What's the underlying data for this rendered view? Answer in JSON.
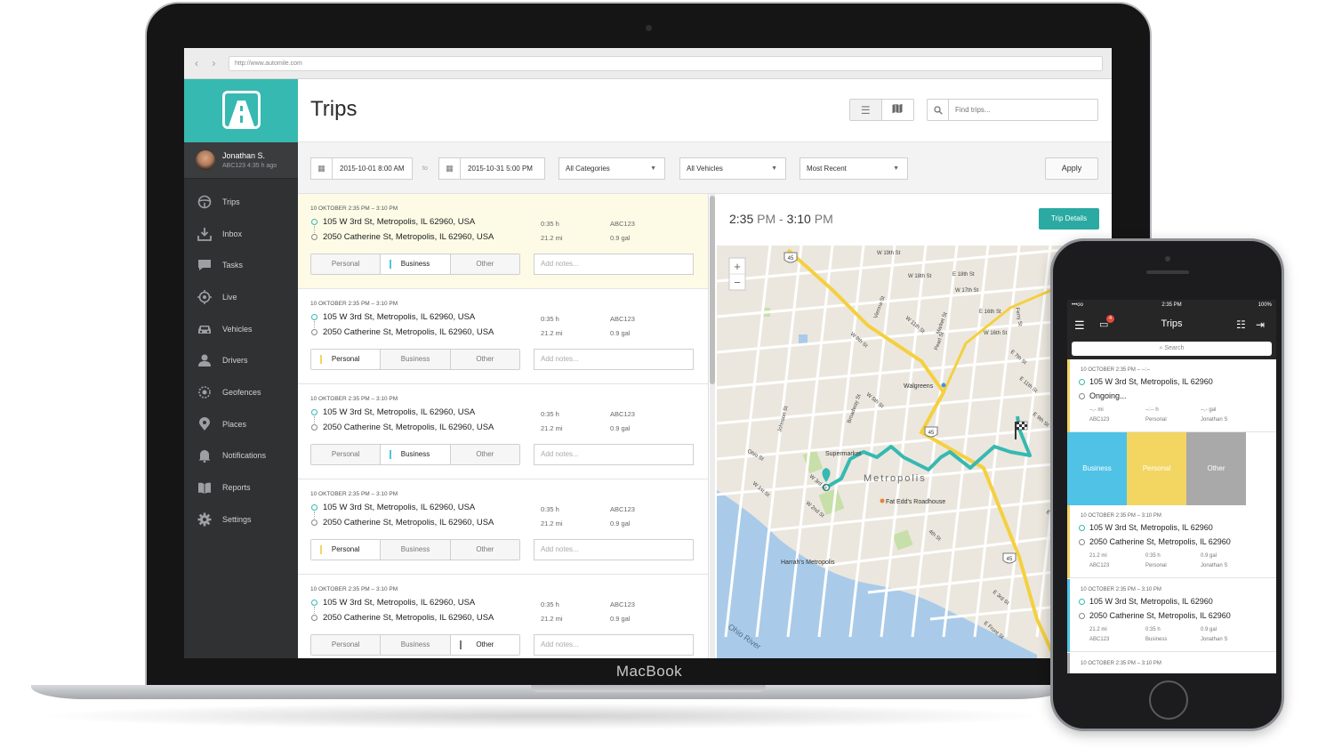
{
  "device": {
    "brand": "MacBook"
  },
  "browser": {
    "url": "http://www.automile.com"
  },
  "colors": {
    "accent": "#36b9b1",
    "personal": "#f3d561",
    "business": "#4fc2e6",
    "other": "#a9a9a9",
    "sidebar": "#2f3133"
  },
  "user": {
    "name": "Jonathan S.",
    "sub": "ABC123 4:35 h ago"
  },
  "sidebar": {
    "items": [
      {
        "label": "Trips",
        "icon": "steering-wheel-icon"
      },
      {
        "label": "Inbox",
        "icon": "inbox-download-icon"
      },
      {
        "label": "Tasks",
        "icon": "chat-bubble-icon"
      },
      {
        "label": "Live",
        "icon": "crosshair-icon"
      },
      {
        "label": "Vehicles",
        "icon": "car-icon"
      },
      {
        "label": "Drivers",
        "icon": "person-icon"
      },
      {
        "label": "Geofences",
        "icon": "geofence-icon"
      },
      {
        "label": "Places",
        "icon": "map-pin-icon"
      },
      {
        "label": "Notifications",
        "icon": "bell-icon"
      },
      {
        "label": "Reports",
        "icon": "book-icon"
      },
      {
        "label": "Settings",
        "icon": "gear-icon"
      }
    ]
  },
  "header": {
    "title": "Trips",
    "search_placeholder": "Find trips..."
  },
  "filters": {
    "date_from": "2015-10-01 8:00 AM",
    "to_label": "to",
    "date_to": "2015-10-31 5:00 PM",
    "category": "All Categories",
    "vehicle": "All Vehicles",
    "sort": "Most Recent",
    "apply_label": "Apply"
  },
  "categories": {
    "personal": "Personal",
    "business": "Business",
    "other": "Other",
    "notes_placeholder": "Add notes..."
  },
  "trips": [
    {
      "time": "10 OKTOBER 2:35 PM – 3:10 PM",
      "from": "105 W 3rd St, Metropolis, IL 62960, USA",
      "to": "2050 Catherine St, Metropolis, IL 62960, USA",
      "duration": "0:35 h",
      "distance": "21.2 mi",
      "vehicle": "ABC123",
      "fuel": "0.9 gal",
      "category": "business",
      "highlighted": true
    },
    {
      "time": "10 OKTOBER 2:35 PM – 3:10 PM",
      "from": "105 W 3rd St, Metropolis, IL 62960, USA",
      "to": "2050 Catherine St, Metropolis, IL 62960, USA",
      "duration": "0:35 h",
      "distance": "21.2 mi",
      "vehicle": "ABC123",
      "fuel": "0.9 gal",
      "category": "personal",
      "highlighted": false
    },
    {
      "time": "10 OKTOBER 2:35 PM – 3:10 PM",
      "from": "105 W 3rd St, Metropolis, IL 62960, USA",
      "to": "2050 Catherine St, Metropolis, IL 62960, USA",
      "duration": "0:35 h",
      "distance": "21.2 mi",
      "vehicle": "ABC123",
      "fuel": "0.9 gal",
      "category": "business",
      "highlighted": false
    },
    {
      "time": "10 OKTOBER 2:35 PM – 3:10 PM",
      "from": "105 W 3rd St, Metropolis, IL 62960, USA",
      "to": "2050 Catherine St, Metropolis, IL 62960, USA",
      "duration": "0:35 h",
      "distance": "21.2 mi",
      "vehicle": "ABC123",
      "fuel": "0.9 gal",
      "category": "personal",
      "highlighted": false
    },
    {
      "time": "10 OKTOBER 2:35 PM – 3:10 PM",
      "from": "105 W 3rd St, Metropolis, IL 62960, USA",
      "to": "2050 Catherine St, Metropolis, IL 62960, USA",
      "duration": "0:35 h",
      "distance": "21.2 mi",
      "vehicle": "ABC123",
      "fuel": "0.9 gal",
      "category": "other",
      "highlighted": false
    }
  ],
  "detail": {
    "start": "2:35",
    "start_ampm": "PM",
    "sep": " - ",
    "end": "3:10",
    "end_ampm": "PM",
    "button": "Trip Details"
  },
  "map": {
    "zoom_in": "+",
    "zoom_out": "−",
    "city_label": "Metropolis",
    "river_label": "Ohio River",
    "poi": [
      "Walgreens",
      "Fat Edd's Roadhouse",
      "Harrah's Metropolis",
      "Supermarket"
    ],
    "streets": [
      "W 19th St",
      "E 18th St",
      "W 18th St",
      "E 16th St",
      "W 17th St",
      "W 16th St",
      "W 11th St",
      "W 9th St",
      "W 5th St",
      "W 3rd St",
      "W 2nd St",
      "W 1st St",
      "Market St",
      "Ferry St",
      "Vienna St",
      "Pearl St",
      "Broadway St",
      "Johnson St",
      "Ohio St",
      "E 11th St",
      "E 9th St",
      "E 6th St",
      "E 3rd St",
      "E Front St",
      "E 7th St",
      "4th St"
    ],
    "route_shields": [
      "45",
      "45",
      "45"
    ]
  },
  "phone": {
    "carrier": "•••oo",
    "time": "2:35 PM",
    "battery": "100%",
    "title": "Trips",
    "badge": "4",
    "search_placeholder": "Search",
    "ongoing": {
      "time": "10 OCTOBER 2:35 PM – --:--",
      "from": "105 W 3rd St, Metropolis, IL 62960",
      "status": "Ongoing...",
      "distance": "--,- mi",
      "duration": "--:-- h",
      "fuel": "--,- gal",
      "vehicle": "ABC123",
      "category": "Personal",
      "driver": "Jonathan S"
    },
    "actions": [
      "Business",
      "Personal",
      "Other"
    ],
    "cards": [
      {
        "time": "10 OCTOBER 2:35 PM – 3:10 PM",
        "from": "105 W 3rd St, Metropolis, IL 62960",
        "to": "2050 Catherine St, Metropolis, IL 62960",
        "distance": "21.2 mi",
        "duration": "0:35 h",
        "fuel": "0.9 gal",
        "vehicle": "ABC123",
        "category": "Personal",
        "driver": "Jonathan S"
      },
      {
        "time": "10 OCTOBER 2:35 PM – 3:10 PM",
        "from": "105 W 3rd St, Metropolis, IL 62960",
        "to": "2050 Catherine St, Metropolis, IL 62960",
        "distance": "21.2 mi",
        "duration": "0:35 h",
        "fuel": "0.9 gal",
        "vehicle": "ABC123",
        "category": "Business",
        "driver": "Jonathan S"
      },
      {
        "time": "10 OCTOBER 2:35 PM – 3:10 PM"
      }
    ]
  }
}
